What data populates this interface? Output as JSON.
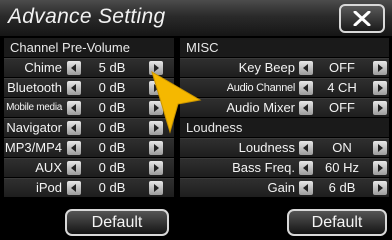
{
  "header": {
    "title": "Advance Setting",
    "close_icon": "close-x-icon"
  },
  "left_panel": {
    "heading": "Channel Pre-Volume",
    "rows": [
      {
        "label": "Chime",
        "value": "5 dB"
      },
      {
        "label": "Bluetooth",
        "value": "0 dB"
      },
      {
        "label": "Mobile media",
        "value": "0 dB"
      },
      {
        "label": "Navigator",
        "value": "0 dB"
      },
      {
        "label": "MP3/MP4",
        "value": "0 dB"
      },
      {
        "label": "AUX",
        "value": "0 dB"
      },
      {
        "label": "iPod",
        "value": "0 dB"
      }
    ],
    "default_label": "Default"
  },
  "right_panel": {
    "misc_heading": "MISC",
    "misc_rows": [
      {
        "label": "Key Beep",
        "value": "OFF"
      },
      {
        "label": "Audio Channel",
        "value": "4 CH"
      },
      {
        "label": "Audio Mixer",
        "value": "OFF"
      }
    ],
    "loudness_heading": "Loudness",
    "loudness_rows": [
      {
        "label": "Loudness",
        "value": "ON"
      },
      {
        "label": "Bass Freq.",
        "value": "60 Hz"
      },
      {
        "label": "Gain",
        "value": "6 dB"
      }
    ],
    "default_label": "Default"
  },
  "colors": {
    "accent_cursor": "#f5b800",
    "background": "#000000"
  }
}
